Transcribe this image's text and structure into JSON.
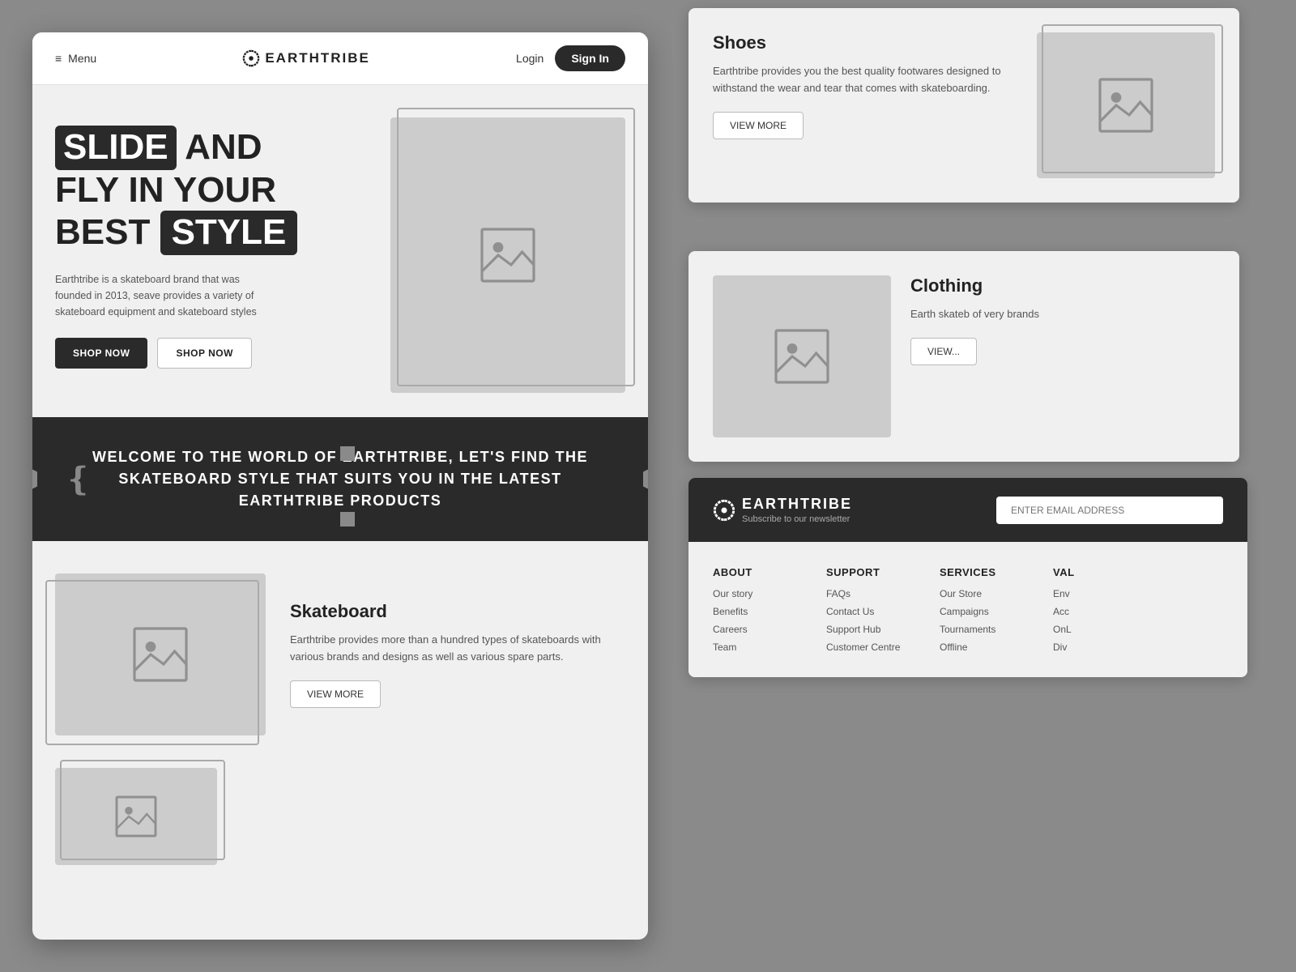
{
  "brand": {
    "name": "EARTHTRIBE",
    "logo_symbol": "⟲",
    "tagline": "Subscribe to our newsletter"
  },
  "header": {
    "menu_label": "Menu",
    "login_label": "Login",
    "signin_label": "Sign In"
  },
  "hero": {
    "title_line1_plain": "AND",
    "title_line1_highlight": "SLIDE",
    "title_line2": "FLY IN YOUR",
    "title_line3_plain": "BEST",
    "title_line3_highlight": "STYLE",
    "description": "Earthtribe is a skateboard brand that was founded in 2013, seave provides a variety of skateboard equipment and skateboard styles",
    "cta_primary": "SHOP NOW",
    "cta_secondary": "SHOP NOW"
  },
  "welcome_banner": {
    "text": "WELCOME TO THE WORLD OF EARTHTRIBE, LET'S FIND THE SKATEBOARD STYLE THAT SUITS YOU IN THE LATEST EARTHTRIBE PRODUCTS"
  },
  "products": {
    "skateboard": {
      "title": "Skateboard",
      "description": "Earthtribe provides more than a hundred types of skateboards with various brands and designs as well as various spare parts.",
      "cta": "VIEW MORE"
    },
    "shoes": {
      "title": "Shoes",
      "description": "Earthtribe provides you the best quality footwares designed to withstand the wear and tear that comes with skateboarding.",
      "cta": "VIEW MORE"
    },
    "clothing": {
      "title": "Clot",
      "description": "Earth skateb of very brands",
      "cta": "VIEW"
    }
  },
  "newsletter": {
    "input_placeholder": "ENTER EMAIL ADDRESS"
  },
  "footer": {
    "columns": [
      {
        "title": "ABOUT",
        "items": [
          "Our story",
          "Benefits",
          "Careers",
          "Team"
        ]
      },
      {
        "title": "SUPPORT",
        "items": [
          "FAQs",
          "Contact Us",
          "Support Hub",
          "Customer Centre"
        ]
      },
      {
        "title": "SERVICES",
        "items": [
          "Our Store",
          "Campaigns",
          "Tournaments",
          "Offline"
        ]
      },
      {
        "title": "VAL",
        "items": [
          "Env",
          "Acc",
          "OnL",
          "Div"
        ]
      }
    ]
  },
  "icons": {
    "image_placeholder": "🖼",
    "menu_bars": "≡"
  }
}
